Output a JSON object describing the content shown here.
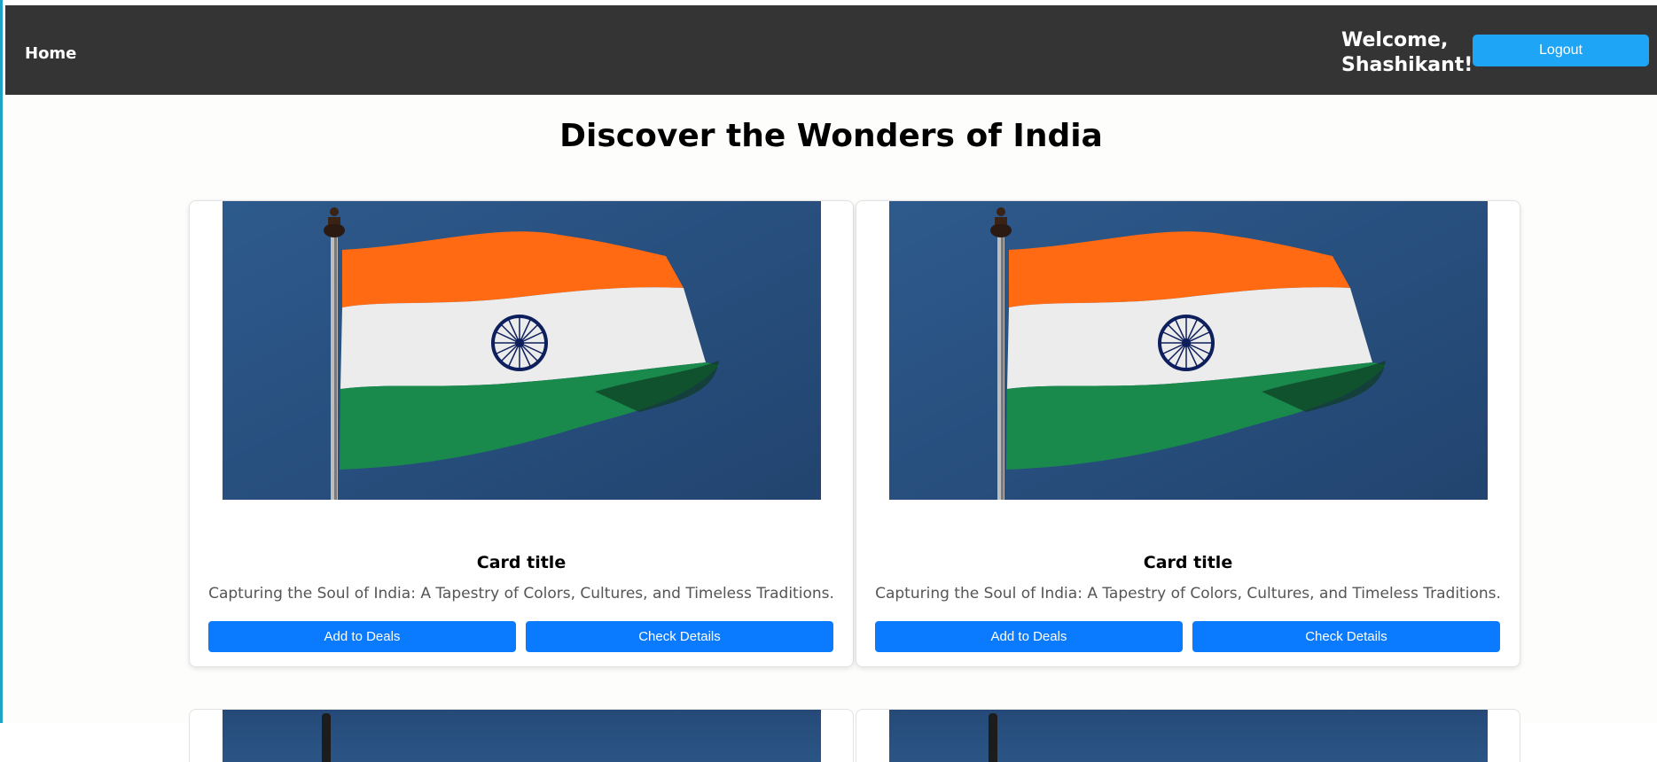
{
  "navbar": {
    "home_label": "Home",
    "welcome_text": "Welcome, Shashikant!",
    "logout_label": "Logout"
  },
  "page": {
    "title": "Discover the Wonders of India"
  },
  "cards": [
    {
      "title": "Card title",
      "description": "Capturing the Soul of India: A Tapestry of Colors, Cultures, and Timeless Traditions.",
      "add_label": "Add to Deals",
      "details_label": "Check Details",
      "image": "indian-flag-image"
    },
    {
      "title": "Card title",
      "description": "Capturing the Soul of India: A Tapestry of Colors, Cultures, and Timeless Traditions.",
      "add_label": "Add to Deals",
      "details_label": "Check Details",
      "image": "indian-flag-image"
    }
  ],
  "colors": {
    "navbar_bg": "#343434",
    "logout_button": "#1ea5f5",
    "card_button": "#0a7bff",
    "sky": "#2b5585",
    "saffron": "#ff6a13",
    "green": "#1a8a4c",
    "chakra": "#0d1f5c"
  }
}
